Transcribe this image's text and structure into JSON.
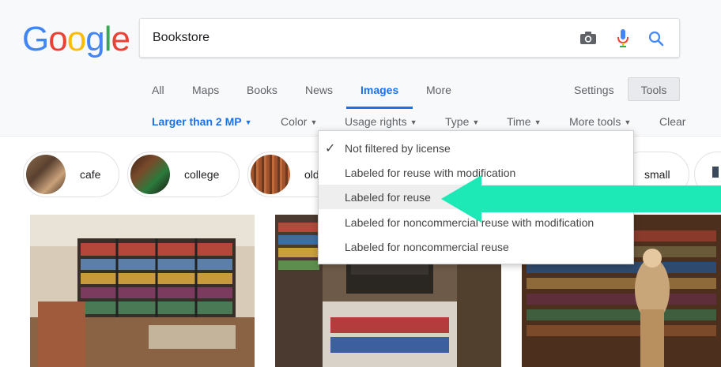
{
  "logo": {
    "letters": [
      "G",
      "o",
      "o",
      "g",
      "l",
      "e"
    ],
    "colors": [
      "#4285F4",
      "#EA4335",
      "#FBBC05",
      "#4285F4",
      "#34A853",
      "#EA4335"
    ]
  },
  "search": {
    "value": "Bookstore",
    "icons": [
      "camera-icon",
      "microphone-icon",
      "search-icon"
    ]
  },
  "nav": {
    "tabs": [
      {
        "label": "All",
        "active": false
      },
      {
        "label": "Maps",
        "active": false
      },
      {
        "label": "Books",
        "active": false
      },
      {
        "label": "News",
        "active": false
      },
      {
        "label": "Images",
        "active": true
      },
      {
        "label": "More",
        "active": false
      }
    ],
    "settings_label": "Settings",
    "tools_label": "Tools"
  },
  "filters": {
    "size": "Larger than 2 MP",
    "color": "Color",
    "usage_rights": "Usage rights",
    "type": "Type",
    "time": "Time",
    "more_tools": "More tools",
    "clear": "Clear"
  },
  "chips": [
    {
      "label": "cafe"
    },
    {
      "label": "college"
    },
    {
      "label": "old"
    },
    {
      "label": "small"
    }
  ],
  "usage_menu": {
    "items": [
      {
        "label": "Not filtered by license",
        "checked": true,
        "highlighted": false
      },
      {
        "label": "Labeled for reuse with modification",
        "checked": false,
        "highlighted": false
      },
      {
        "label": "Labeled for reuse",
        "checked": false,
        "highlighted": true
      },
      {
        "label": "Labeled for noncommercial reuse with modification",
        "checked": false,
        "highlighted": false
      },
      {
        "label": "Labeled for noncommercial reuse",
        "checked": false,
        "highlighted": false
      }
    ]
  },
  "annotation": {
    "arrow_color": "#1de9b6",
    "points_to": "Labeled for reuse"
  },
  "colors": {
    "accent": "#1a73e8",
    "header_bg": "#f8f9fa"
  }
}
